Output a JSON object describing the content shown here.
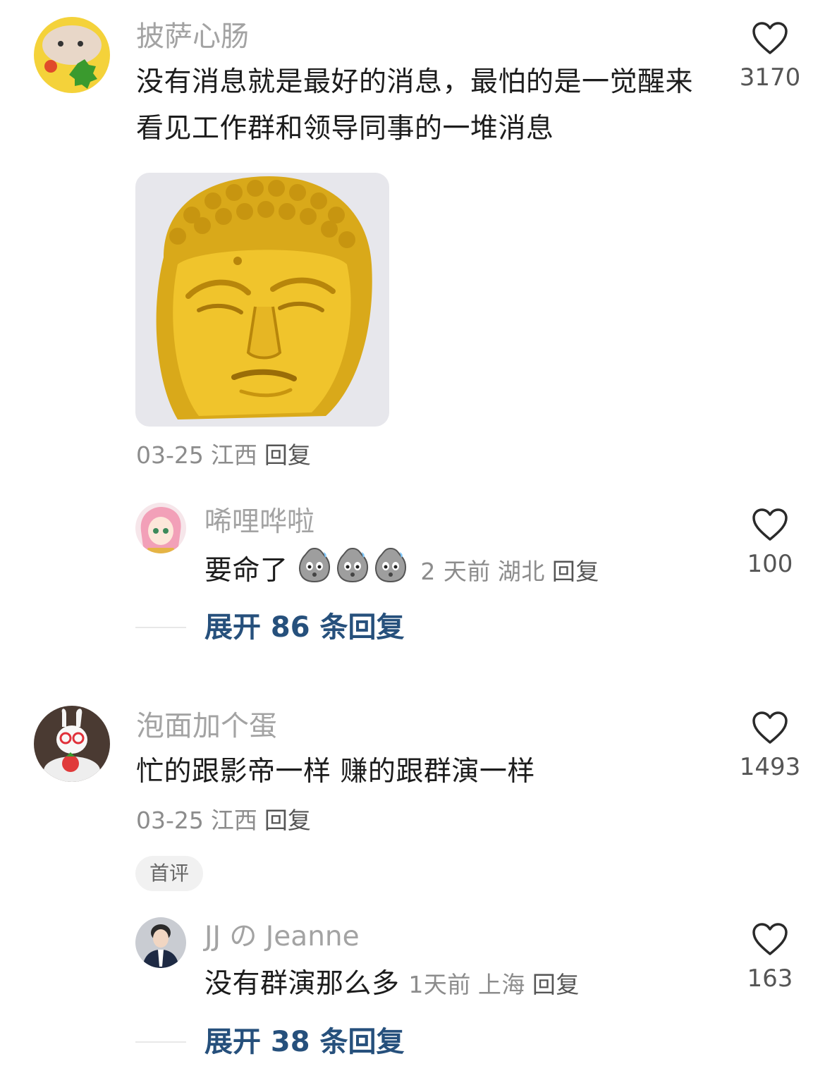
{
  "comments": [
    {
      "username": "披萨心肠",
      "content": "没有消息就是最好的消息，最怕的是一觉醒来看见工作群和领导同事的一堆消息",
      "has_image": true,
      "image_icon": "golden-buddha-head-meme",
      "date": "03-25",
      "location": "江西",
      "reply_label": "回复",
      "likes": "3170",
      "badge": "",
      "replies": [
        {
          "username": "唏哩哗啦",
          "content": "要命了",
          "emoji_icons": [
            "sweating-potato-emoji",
            "sweating-potato-emoji",
            "sweating-potato-emoji"
          ],
          "time": "2 天前",
          "location": "湖北",
          "reply_label": "回复",
          "likes": "100"
        }
      ],
      "expand_label": "展开 86 条回复"
    },
    {
      "username": "泡面加个蛋",
      "content": "忙的跟影帝一样 赚的跟群演一样",
      "has_image": false,
      "date": "03-25",
      "location": "江西",
      "reply_label": "回复",
      "likes": "1493",
      "badge": "首评",
      "replies": [
        {
          "username": "JJ の Jeanne",
          "content": "没有群演那么多",
          "emoji_icons": [],
          "time": "1天前",
          "location": "上海",
          "reply_label": "回复",
          "likes": "163"
        }
      ],
      "expand_label": "展开 38 条回复"
    }
  ],
  "icons": {
    "like": "heart-outline-icon"
  },
  "colors": {
    "username": "#a3a3a3",
    "text": "#1c1c1c",
    "expand_link": "#26507c",
    "gold": "#e0b520"
  }
}
